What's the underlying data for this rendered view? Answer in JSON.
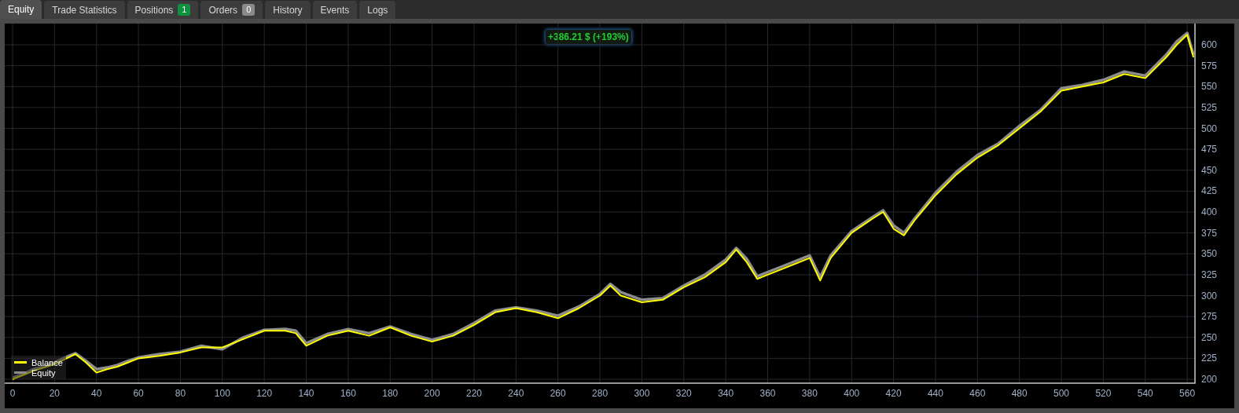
{
  "tabs": [
    {
      "label": "Equity",
      "selected": true
    },
    {
      "label": "Trade Statistics",
      "selected": false
    },
    {
      "label": "Positions",
      "selected": false,
      "badge": {
        "text": "1",
        "color": "#0f9140"
      }
    },
    {
      "label": "Orders",
      "selected": false,
      "badge": {
        "text": "0",
        "color": "#8a8a8a"
      }
    },
    {
      "label": "History",
      "selected": false
    },
    {
      "label": "Events",
      "selected": false
    },
    {
      "label": "Logs",
      "selected": false
    }
  ],
  "profit_label": "+386.21 $ (+193%)",
  "chart_data": {
    "type": "line",
    "x": [
      0,
      5,
      10,
      15,
      20,
      25,
      30,
      35,
      40,
      45,
      50,
      55,
      60,
      70,
      80,
      90,
      100,
      110,
      120,
      130,
      135,
      140,
      150,
      160,
      170,
      180,
      190,
      200,
      210,
      220,
      230,
      240,
      250,
      260,
      270,
      280,
      285,
      290,
      300,
      310,
      320,
      330,
      340,
      345,
      350,
      355,
      360,
      370,
      380,
      385,
      390,
      400,
      410,
      415,
      420,
      425,
      430,
      440,
      450,
      460,
      470,
      480,
      490,
      500,
      510,
      520,
      530,
      540,
      550,
      555,
      560,
      563
    ],
    "series": [
      {
        "name": "Balance",
        "color": "#ffff00",
        "values": [
          200,
          205,
          210,
          214,
          218,
          224,
          230,
          220,
          208,
          212,
          215,
          220,
          225,
          228,
          232,
          238,
          238,
          248,
          258,
          258,
          255,
          240,
          252,
          258,
          252,
          262,
          252,
          245,
          252,
          265,
          280,
          285,
          280,
          273,
          285,
          300,
          312,
          300,
          292,
          295,
          310,
          322,
          340,
          355,
          340,
          320,
          325,
          335,
          345,
          318,
          345,
          375,
          392,
          400,
          380,
          372,
          390,
          420,
          445,
          465,
          480,
          500,
          520,
          545,
          550,
          555,
          565,
          560,
          585,
          600,
          612,
          585
        ]
      },
      {
        "name": "Equity",
        "color": "#8c8c8c",
        "values": [
          202,
          206,
          212,
          215,
          220,
          226,
          231,
          222,
          212,
          214,
          217,
          222,
          226,
          230,
          233,
          240,
          236,
          250,
          259,
          260,
          258,
          243,
          254,
          260,
          255,
          263,
          254,
          247,
          254,
          267,
          282,
          286,
          282,
          276,
          287,
          302,
          314,
          304,
          295,
          297,
          312,
          325,
          343,
          357,
          344,
          323,
          328,
          338,
          348,
          322,
          348,
          377,
          394,
          402,
          384,
          375,
          392,
          423,
          448,
          468,
          482,
          503,
          522,
          548,
          552,
          558,
          568,
          563,
          588,
          604,
          614,
          588
        ]
      }
    ],
    "xlim": [
      -3.75,
      563.7
    ],
    "ylim": [
      195.3,
      625.4
    ],
    "grid": true,
    "legend": "lower left",
    "xticks": [
      0,
      20,
      40,
      60,
      80,
      100,
      120,
      140,
      160,
      180,
      200,
      220,
      240,
      260,
      280,
      300,
      320,
      340,
      360,
      380,
      400,
      420,
      440,
      460,
      480,
      500,
      520,
      540,
      560
    ],
    "yticks": [
      200,
      225,
      250,
      275,
      300,
      325,
      350,
      375,
      400,
      425,
      450,
      475,
      500,
      525,
      550,
      575,
      600
    ]
  }
}
